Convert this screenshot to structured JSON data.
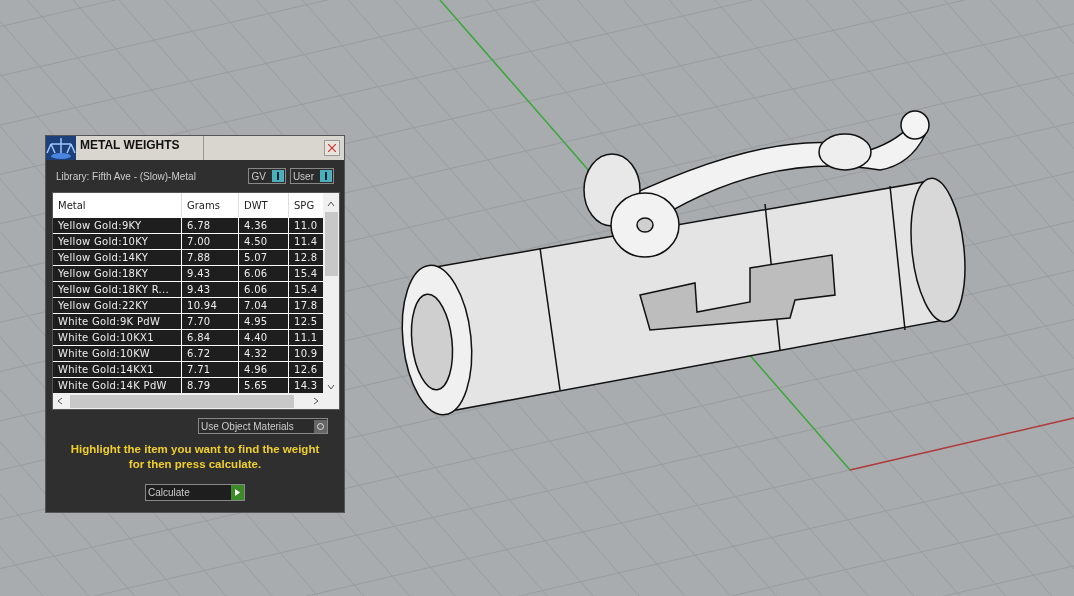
{
  "panel": {
    "title": "METAL WEIGHTS",
    "library": "Library: Fifth Ave - (Slow)-Metal",
    "toggles": [
      {
        "label": "GV",
        "on": true
      },
      {
        "label": "User",
        "on": true
      }
    ],
    "table": {
      "columns": [
        "Metal",
        "Grams",
        "DWT",
        "SPG"
      ],
      "rows": [
        [
          "Yellow Gold:9KY",
          "6.78",
          "4.36",
          "11.0"
        ],
        [
          "Yellow Gold:10KY",
          "7.00",
          "4.50",
          "11.4"
        ],
        [
          "Yellow Gold:14KY",
          "7.88",
          "5.07",
          "12.8"
        ],
        [
          "Yellow Gold:18KY",
          "9.43",
          "6.06",
          "15.4"
        ],
        [
          "Yellow Gold:18KY R...",
          "9.43",
          "6.06",
          "15.4"
        ],
        [
          "Yellow Gold:22KY",
          "10.94",
          "7.04",
          "17.8"
        ],
        [
          "White Gold:9K PdW",
          "7.70",
          "4.95",
          "12.5"
        ],
        [
          "White Gold:10KX1",
          "6.84",
          "4.40",
          "11.1"
        ],
        [
          "White Gold:10KW",
          "6.72",
          "4.32",
          "10.9"
        ],
        [
          "White Gold:14KX1",
          "7.71",
          "4.96",
          "12.6"
        ],
        [
          "White Gold:14K PdW",
          "8.79",
          "5.65",
          "14.3"
        ]
      ]
    },
    "materials_toggle": {
      "label": "Use Object Materials",
      "on": false
    },
    "instruction": "Highlight the item you want to find the weight for then press calculate.",
    "calculate_button": "Calculate"
  }
}
